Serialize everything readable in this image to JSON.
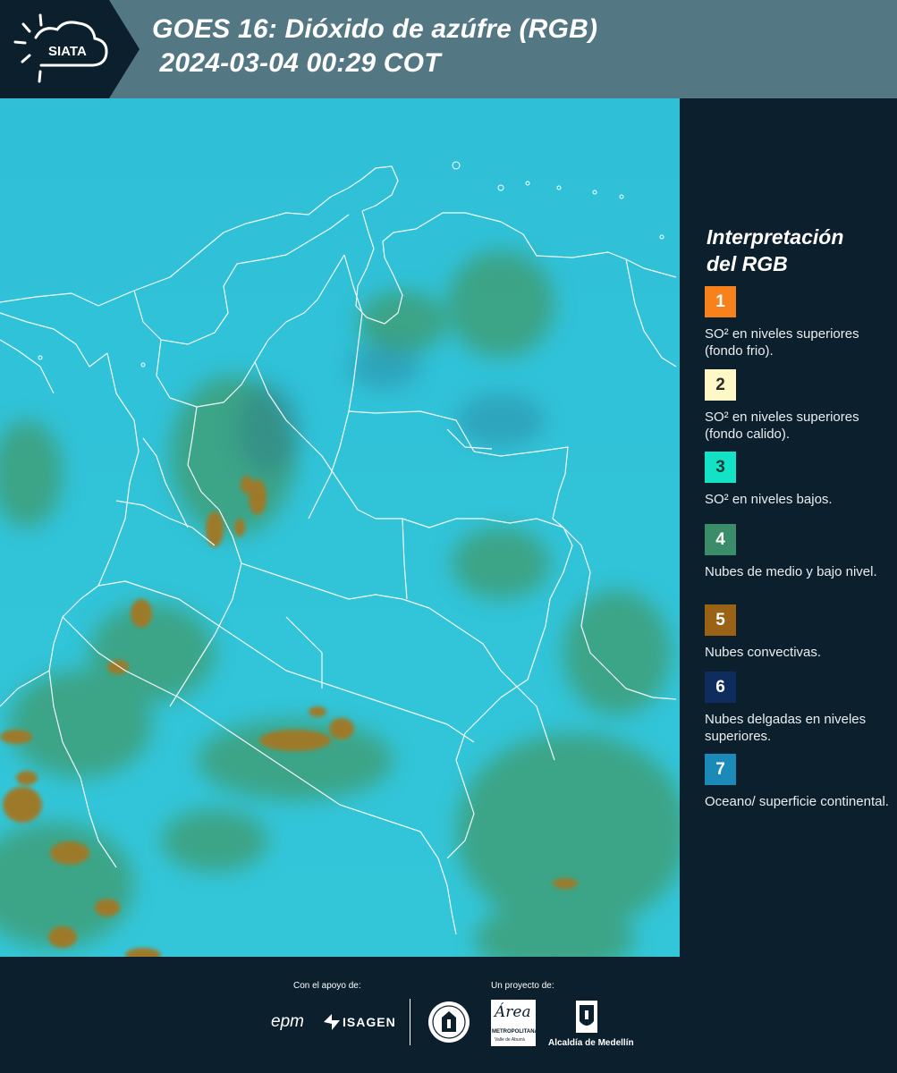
{
  "header": {
    "logo_text": "SIATA",
    "title_line1": "GOES 16: Dióxido de azúfre (RGB)",
    "title_line2": " 2024-03-04 00:29 COT"
  },
  "legend": {
    "title_line1": "Interpretación",
    "title_line2": "del RGB",
    "items": [
      {
        "num": "1",
        "color": "#f7821b",
        "text_color": "#ffffff",
        "desc": "SO² en niveles superiores (fondo frio)."
      },
      {
        "num": "2",
        "color": "#fdf8c6",
        "text_color": "#2b2b2b",
        "desc": "SO² en niveles superiores (fondo calido)."
      },
      {
        "num": "3",
        "color": "#12e2c5",
        "text_color": "#1d3b3a",
        "desc": "SO² en niveles bajos."
      },
      {
        "num": "4",
        "color": "#3a8d68",
        "text_color": "#ffffff",
        "desc": "Nubes de medio y bajo nivel."
      },
      {
        "num": "5",
        "color": "#9a6214",
        "text_color": "#ffffff",
        "desc": "Nubes convectivas."
      },
      {
        "num": "6",
        "color": "#0f2c5e",
        "text_color": "#ffffff",
        "desc": "Nubes delgadas en niveles superiores."
      },
      {
        "num": "7",
        "color": "#1c8ab8",
        "text_color": "#ffffff",
        "desc": "Oceano/ superficie continental."
      }
    ]
  },
  "footer": {
    "support_label": "Con el apoyo de:",
    "project_label": "Un proyecto de:",
    "epm": "epm",
    "isagen": "ISAGEN",
    "area_script": "Área",
    "metropolitana": "METROPOLITANA",
    "valle": "Valle de Aburrá",
    "alcaldia": "Alcaldía de Medellín"
  },
  "colors": {
    "header_bg": "#547784",
    "logo_bg": "#0c1f2d",
    "map_base": "#32c3d9",
    "sidebar_bg": "#0c1f2d"
  }
}
